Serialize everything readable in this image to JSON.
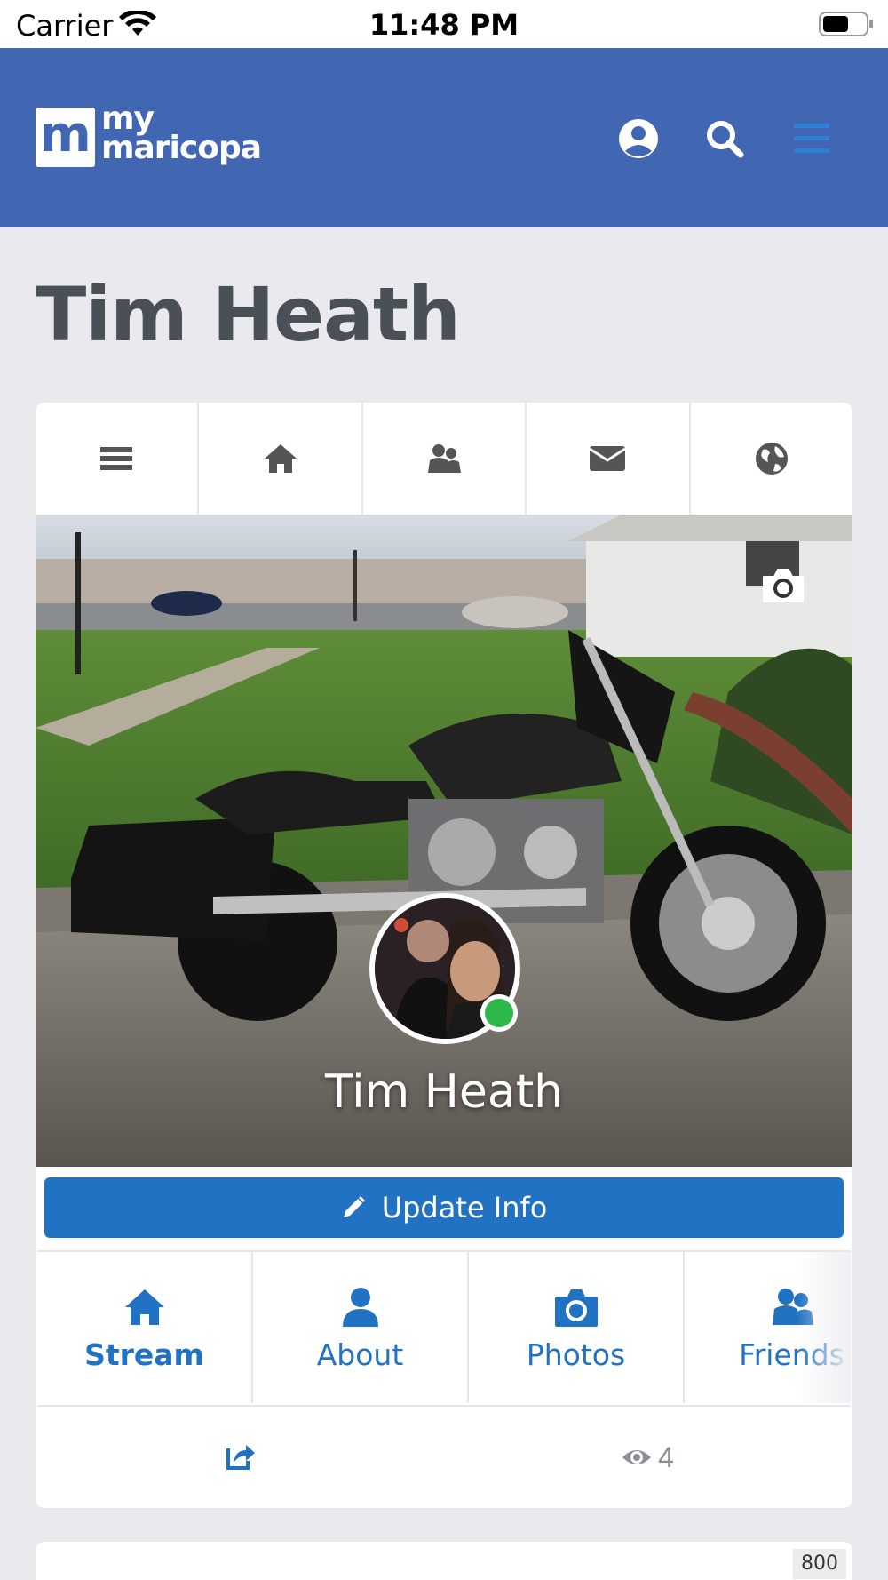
{
  "status_bar": {
    "carrier": "Carrier",
    "time": "11:48 PM"
  },
  "header": {
    "logo_mark": "m",
    "logo_line1": "my",
    "logo_line2": "maricopa",
    "icons": [
      "user-circle-icon",
      "search-icon",
      "hamburger-menu-icon"
    ]
  },
  "page_title": "Tim Heath",
  "icon_bar": [
    "menu-bars-icon",
    "home-icon",
    "users-icon",
    "envelope-icon",
    "globe-icon"
  ],
  "cover": {
    "name": "Tim Heath",
    "online": true
  },
  "update_button": {
    "label": "Update Info"
  },
  "profile_nav": [
    {
      "label": "Stream",
      "icon": "home-icon",
      "active": true
    },
    {
      "label": "About",
      "icon": "user-icon",
      "active": false
    },
    {
      "label": "Photos",
      "icon": "camera-icon",
      "active": false
    },
    {
      "label": "Friends",
      "icon": "users-icon",
      "active": false
    }
  ],
  "actions": {
    "views": "4"
  },
  "badge": "800",
  "colors": {
    "header": "#4267b2",
    "accent": "#2272c3",
    "online": "#2fb84a",
    "title": "#4a5058"
  }
}
